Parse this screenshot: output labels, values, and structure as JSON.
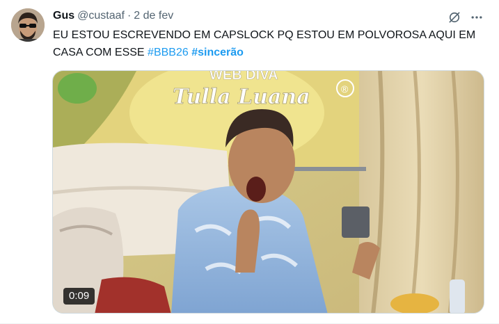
{
  "tweet": {
    "author_name": "Gus",
    "author_handle": "@custaaf",
    "separator": "·",
    "date": "2 de fev",
    "text_main": "EU ESTOU ESCREVENDO EM CAPSLOCK PQ ESTOU EM POLVOROSA AQUI EM CASA COM ESSE",
    "hashtags": [
      "#BBB26",
      "#sincerão"
    ],
    "hashtag_color": "#1d9bf0",
    "icons": {
      "grok": "grok-icon",
      "more": "more-horizontal-icon"
    }
  },
  "video": {
    "duration": "0:09",
    "watermark_line1": "WEB DIVA",
    "watermark_line2": "Tulla Luana",
    "watermark_mark": "®"
  }
}
